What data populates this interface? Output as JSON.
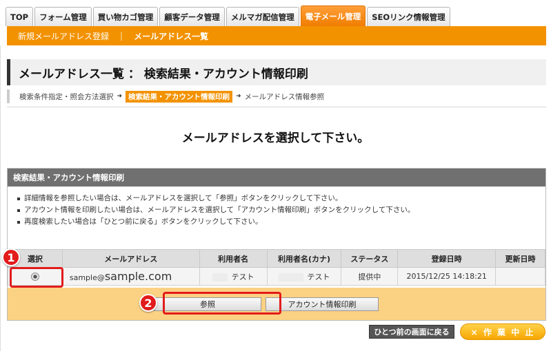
{
  "tabs": [
    "TOP",
    "フォーム管理",
    "買い物カゴ管理",
    "顧客データ管理",
    "メルマガ配信管理",
    "電子メール管理",
    "SEOリンク情報管理"
  ],
  "subnav": {
    "items": [
      "新規メールアドレス登録",
      "メールアドレス一覧"
    ],
    "separator": "|"
  },
  "page_title": "メールアドレス一覧 ： 検索結果・アカウント情報印刷",
  "breadcrumb": [
    "検索条件指定・照会方法選択",
    "検索結果・アカウント情報印刷",
    "メールアドレス情報参照"
  ],
  "instruction": "メールアドレスを選択して下さい。",
  "panel": {
    "header": "検索結果・アカウント情報印刷",
    "notes": [
      "詳細情報を参照したい場合は、メールアドレスを選択して「参照」ボタンをクリックして下さい。",
      "アカウント情報を印刷したい場合は、メールアドレスを選択して「アカウント情報印刷」ボタンをクリックして下さい。",
      "再度検索したい場合は「ひとつ前に戻る」ボタンをクリックして下さい。"
    ],
    "columns": [
      "選択",
      "メールアドレス",
      "利用者名",
      "利用者名(カナ)",
      "ステータス",
      "登録日時",
      "更新日時"
    ],
    "row": {
      "email_local": "sample@",
      "email_domain": "sample.com",
      "user_name": "テスト",
      "user_name_kana": "テスト",
      "status": "提供中",
      "registered": "2015/12/25 14:18:21",
      "updated": ""
    },
    "buttons": {
      "view": "参照",
      "print": "アカウント情報印刷"
    }
  },
  "callouts": [
    "1",
    "2"
  ],
  "footer": {
    "back": "ひとつ前の画面に戻る",
    "stop": "× 作 業 中 止"
  },
  "colors": {
    "accent": "#f39200",
    "highlight": "#e21b1b"
  }
}
